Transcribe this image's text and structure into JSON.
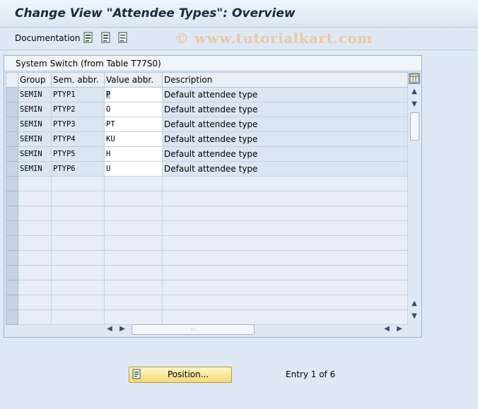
{
  "title": "Change View \"Attendee Types\": Overview",
  "toolbar": {
    "documentation_label": "Documentation",
    "icons": [
      "select-all-icon",
      "select-block-icon",
      "deselect-all-icon"
    ]
  },
  "watermark": "© www.tutorialkart.com",
  "panel": {
    "title": "System Switch (from Table T77S0)",
    "columns": [
      "Group",
      "Sem. abbr.",
      "Value abbr.",
      "Description"
    ],
    "rows": [
      {
        "group": "SEMIN",
        "sem": "PTYP1",
        "value": "P",
        "desc": "Default attendee type"
      },
      {
        "group": "SEMIN",
        "sem": "PTYP2",
        "value": "O",
        "desc": "Default attendee type"
      },
      {
        "group": "SEMIN",
        "sem": "PTYP3",
        "value": "PT",
        "desc": "Default attendee type"
      },
      {
        "group": "SEMIN",
        "sem": "PTYP4",
        "value": "KU",
        "desc": "Default attendee type"
      },
      {
        "group": "SEMIN",
        "sem": "PTYP5",
        "value": "H",
        "desc": "Default attendee type"
      },
      {
        "group": "SEMIN",
        "sem": "PTYP6",
        "value": "U",
        "desc": "Default attendee type"
      }
    ]
  },
  "footer": {
    "position_label": "Position...",
    "entry_text": "Entry 1 of 6"
  },
  "colors": {
    "background": "#dfe9f5",
    "button_yellow": "#f3d978"
  }
}
